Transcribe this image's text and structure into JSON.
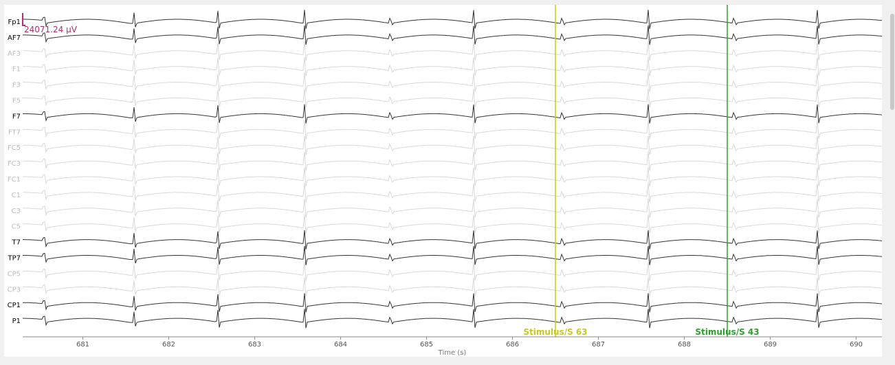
{
  "viewer": {
    "scale_readout": "24071.24 μV",
    "scale_color": "#b0306f",
    "x_axis_title": "Time (s)",
    "x_ticks": [
      "681",
      "682",
      "683",
      "684",
      "685",
      "686",
      "687",
      "688",
      "689",
      "690"
    ]
  },
  "channels": [
    {
      "name": "Fp1",
      "active": true
    },
    {
      "name": "AF7",
      "active": true
    },
    {
      "name": "AF3",
      "active": false
    },
    {
      "name": "F1",
      "active": false
    },
    {
      "name": "F3",
      "active": false
    },
    {
      "name": "F5",
      "active": false
    },
    {
      "name": "F7",
      "active": true
    },
    {
      "name": "FT7",
      "active": false
    },
    {
      "name": "FC5",
      "active": false
    },
    {
      "name": "FC3",
      "active": false
    },
    {
      "name": "FC1",
      "active": false
    },
    {
      "name": "C1",
      "active": false
    },
    {
      "name": "C3",
      "active": false
    },
    {
      "name": "C5",
      "active": false
    },
    {
      "name": "T7",
      "active": true
    },
    {
      "name": "TP7",
      "active": true
    },
    {
      "name": "CP5",
      "active": false
    },
    {
      "name": "CP3",
      "active": false
    },
    {
      "name": "CP1",
      "active": true
    },
    {
      "name": "P1",
      "active": true
    }
  ],
  "markers": [
    {
      "label": "Stimulus/S 63",
      "time": 686.5,
      "color": "#c8c81e"
    },
    {
      "label": "Stimulus/S 43",
      "time": 688.5,
      "color": "#2ca02c"
    }
  ],
  "chart_data": {
    "type": "line",
    "xlim": [
      680.3,
      690.3
    ],
    "xlabel": "Time (s)",
    "spike_times": [
      680.55,
      681.6,
      682.57,
      683.58,
      684.58,
      685.55,
      686.58,
      687.58,
      688.58,
      689.55
    ],
    "colors": {
      "active": "#333333",
      "inactive": "#d8d8d8",
      "active_label": "#000000",
      "inactive_label": "#bbbbbb"
    }
  }
}
